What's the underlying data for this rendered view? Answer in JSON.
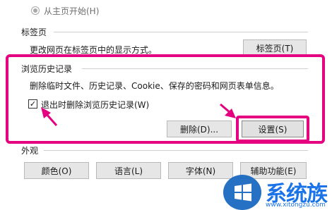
{
  "startup": {
    "radio_label": "从主页开始(H)"
  },
  "tabs": {
    "heading": "标签页",
    "description": "更改网页在标签页中的显示方式。",
    "button_label": "标签页(T)"
  },
  "history": {
    "heading": "浏览历史记录",
    "description": "删除临时文件、历史记录、Cookie、保存的密码和网页表单信息。",
    "checkbox_label": "退出时删除浏览历史记录(W)",
    "checkbox_checked": true,
    "delete_label": "删除(D)...",
    "settings_label": "设置(S)"
  },
  "appearance": {
    "heading": "外观",
    "buttons": [
      "颜色(O)",
      "语言(L)",
      "字体(N)",
      "辅助功能(E)"
    ]
  },
  "watermark": {
    "brand": "系统族",
    "url": "www.xitongzu.com"
  },
  "colors": {
    "highlight": "#e4007f",
    "dialog_bg": "#ffffff",
    "button_bg": "#e6e6e6",
    "logo_blue": "#1565c0"
  }
}
